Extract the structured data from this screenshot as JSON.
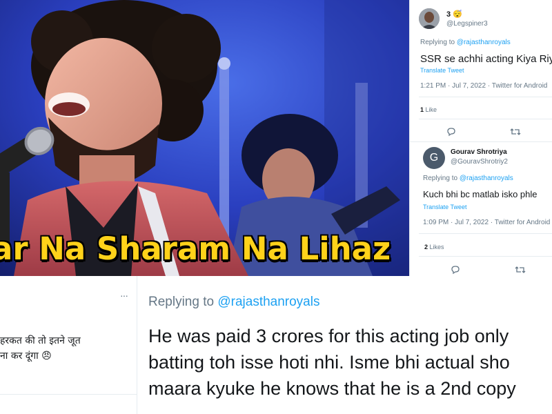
{
  "photo": {
    "caption": "ar Na Sharam Na Lihaz"
  },
  "tweet1": {
    "name": "3",
    "name_emoji": "😴",
    "handle": "@Legspiner3",
    "replying_prefix": "Replying to ",
    "replying_handle": "@rajasthanroyals",
    "text": "SSR se achhi acting Kiya Riya",
    "translate": "Translate Tweet",
    "meta": "1:21 PM · Jul 7, 2022 · Twitter for Android",
    "likes_count": "1",
    "likes_label": "Like",
    "icons": [
      "reply-icon",
      "retweet-icon"
    ]
  },
  "tweet2": {
    "name": "Gourav Shrotriya",
    "handle": "@GouravShrotriy2",
    "avatar_letter": "G",
    "replying_prefix": "Replying to ",
    "replying_handle": "@rajasthanroyals",
    "text": "Kuch bhi bc matlab isko phle",
    "translate": "Translate Tweet",
    "meta": "1:09 PM · Jul 7, 2022 · Twitter for Android",
    "likes_count": "2",
    "likes_label": "Likes",
    "icons": [
      "reply-icon",
      "retweet-icon"
    ]
  },
  "tweet3": {
    "more": "···",
    "line1": "हरकत की तो इतने जूत",
    "line2": "ना कर दूंगा 😠"
  },
  "tweet4": {
    "replying_prefix": "Replying to ",
    "replying_handle": "@rajasthanroyals",
    "lines": [
      "He was paid 3 crores for this acting job only",
      "batting toh isse hoti nhi. Isme bhi actual sho",
      "maara kyuke he knows that he is a 2nd copy"
    ]
  },
  "colors": {
    "accent": "#1da1f2",
    "caption_yellow": "#ffd21a",
    "stage_blue": "#2a47c9"
  }
}
